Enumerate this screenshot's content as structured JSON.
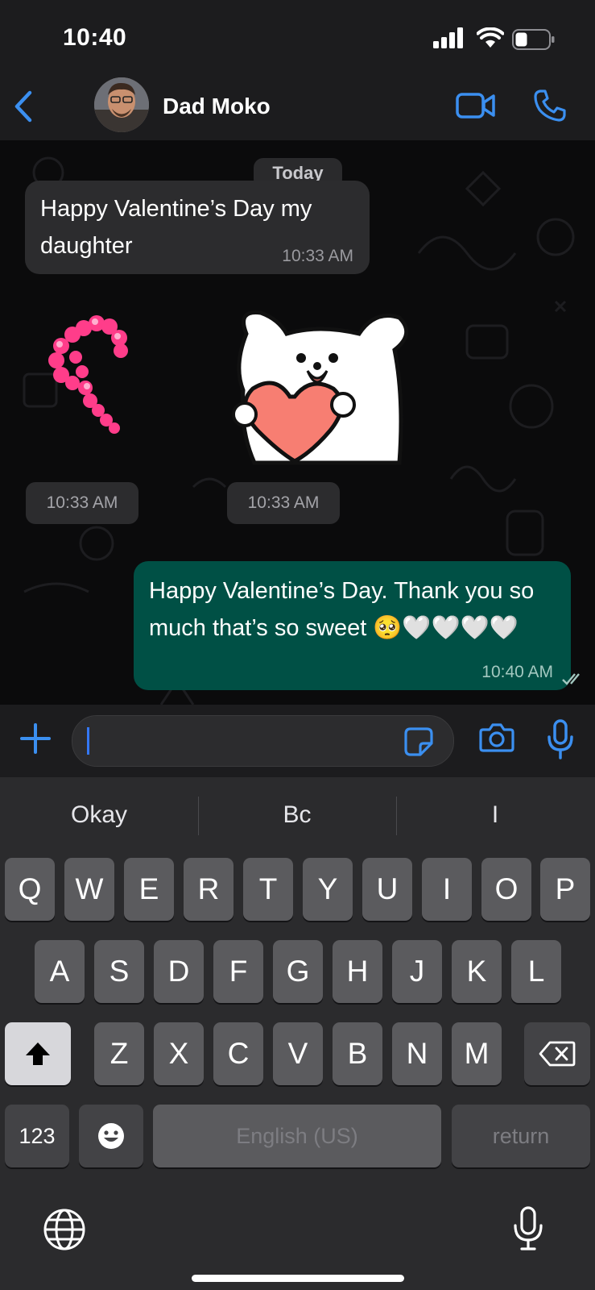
{
  "status_bar": {
    "time": "10:40"
  },
  "header": {
    "contact_name": "Dad Moko"
  },
  "chat": {
    "date_separator": "Today",
    "messages": [
      {
        "direction": "in",
        "text": "Happy Valentine’s Day my daughter",
        "time": "10:33 AM"
      },
      {
        "direction": "in",
        "type": "sticker",
        "subject": "pink hearts",
        "time": "10:33 AM"
      },
      {
        "direction": "in",
        "type": "sticker",
        "subject": "bear holding heart",
        "time": "10:33 AM"
      },
      {
        "direction": "out",
        "text": "Happy Valentine’s Day. Thank you so much that’s so sweet 🥺🤍🤍🤍🤍",
        "time": "10:40 AM",
        "status": "read"
      }
    ]
  },
  "composer": {
    "value": "",
    "placeholder": ""
  },
  "keyboard": {
    "suggestions": [
      "Okay",
      "Bc",
      "I"
    ],
    "row1": [
      "Q",
      "W",
      "E",
      "R",
      "T",
      "Y",
      "U",
      "I",
      "O",
      "P"
    ],
    "row2": [
      "A",
      "S",
      "D",
      "F",
      "G",
      "H",
      "J",
      "K",
      "L"
    ],
    "row3": [
      "Z",
      "X",
      "C",
      "V",
      "B",
      "N",
      "M"
    ],
    "numbers_label": "123",
    "space_label": "English (US)",
    "return_label": "return"
  },
  "colors": {
    "accent": "#3b8ff0",
    "outgoing_bubble": "#005045",
    "incoming_bubble": "#2c2c2e"
  },
  "icons": [
    "back-chevron-icon",
    "video-call-icon",
    "phone-icon",
    "plus-icon",
    "sticker-icon",
    "camera-icon",
    "microphone-icon",
    "shift-icon",
    "backspace-icon",
    "emoji-icon",
    "globe-icon",
    "dictation-icon",
    "read-receipt-icon"
  ]
}
